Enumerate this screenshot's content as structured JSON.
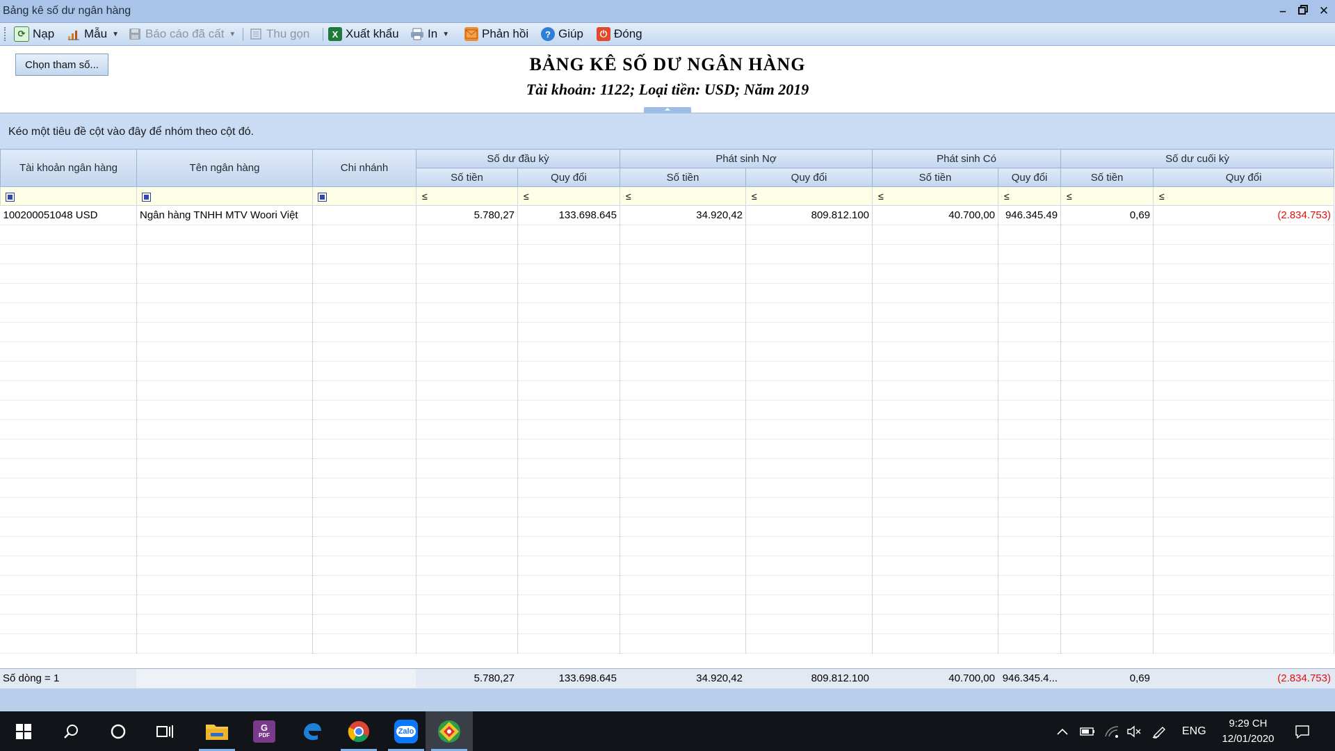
{
  "window": {
    "title": "Bảng kê số dư ngân hàng",
    "controls": [
      "minimize",
      "restore",
      "close"
    ]
  },
  "toolbar": {
    "items": [
      {
        "label": "Nạp",
        "icon": "refresh-icon",
        "enabled": true
      },
      {
        "label": "Mẫu",
        "icon": "chart-icon",
        "enabled": true,
        "dropdown": true
      },
      {
        "label": "Báo cáo đã cất",
        "icon": "save-icon",
        "enabled": false,
        "dropdown": true
      },
      {
        "label": "Thu gọn",
        "icon": "collapse-icon",
        "enabled": false
      },
      {
        "label": "Xuất khẩu",
        "icon": "excel-icon",
        "enabled": true
      },
      {
        "label": "In",
        "icon": "printer-icon",
        "enabled": true,
        "dropdown": true
      },
      {
        "label": "Phản hồi",
        "icon": "mail-icon",
        "enabled": true
      },
      {
        "label": "Giúp",
        "icon": "help-icon",
        "enabled": true
      },
      {
        "label": "Đóng",
        "icon": "close-icon",
        "enabled": true
      }
    ]
  },
  "report": {
    "choose_params_label": "Chọn tham số...",
    "title": "BẢNG KÊ SỐ DƯ NGÂN HÀNG",
    "subtitle": "Tài khoản: 1122; Loại tiền: USD; Năm 2019"
  },
  "group_panel": {
    "hint": "Kéo một tiêu đề cột vào đây để nhóm theo cột đó."
  },
  "grid": {
    "columns": {
      "account": "Tài khoản ngân hàng",
      "bank": "Tên ngân hàng",
      "branch": "Chi nhánh",
      "group_opening": "Số dư đầu kỳ",
      "group_debit": "Phát sinh Nợ",
      "group_credit": "Phát sinh Có",
      "group_closing": "Số dư cuối kỳ",
      "amount": "Số tiền",
      "converted": "Quy đổi"
    },
    "filter_symbol": "≤",
    "rows": [
      {
        "account": "100200051048 USD",
        "bank": "Ngân hàng TNHH MTV Woori Việt",
        "branch": "",
        "opening_amount": "5.780,27",
        "opening_converted": "133.698.645",
        "debit_amount": "34.920,42",
        "debit_converted": "809.812.100",
        "credit_amount": "40.700,00",
        "credit_converted": "946.345.49",
        "closing_amount": "0,69",
        "closing_converted": "(2.834.753)"
      }
    ],
    "footer": {
      "row_count": "Số dòng = 1",
      "opening_amount": "5.780,27",
      "opening_converted": "133.698.645",
      "debit_amount": "34.920,42",
      "debit_converted": "809.812.100",
      "credit_amount": "40.700,00",
      "credit_converted": "946.345.4...",
      "closing_amount": "0,69",
      "closing_converted": "(2.834.753)"
    }
  },
  "taskbar": {
    "apps": [
      "start-icon",
      "search-icon",
      "cortana-icon",
      "task-view-icon",
      "file-explorer-icon",
      "pdf-app-icon",
      "edge-icon",
      "chrome-icon",
      "zalo-icon",
      "accounting-app-icon"
    ],
    "zalo_label": "Zalo",
    "pdf_label": "PDF",
    "language": "ENG",
    "time": "9:29 CH",
    "date": "12/01/2020"
  },
  "colors": {
    "titlebar": "#a9c4e8",
    "group_panel": "#c9dcf3",
    "filter_row": "#fffee6",
    "negative": "#e01010",
    "taskbar": "#111418"
  }
}
